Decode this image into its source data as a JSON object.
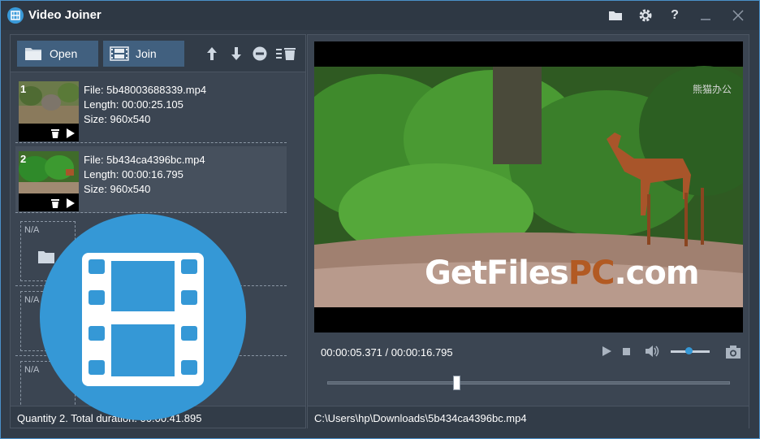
{
  "window": {
    "title": "Video Joiner",
    "accent_color": "#3598d6",
    "titlebar_icons": [
      "folder-icon",
      "gear-icon",
      "help-icon",
      "minimize-icon",
      "close-icon"
    ],
    "help_label": "?"
  },
  "toolbar": {
    "open_label": "Open",
    "join_label": "Join",
    "tools": [
      "move-up-icon",
      "move-down-icon",
      "remove-icon",
      "clear-list-icon"
    ]
  },
  "files": [
    {
      "index": "1",
      "file": "File: 5b48003688339.mp4",
      "length": "Length: 00:00:25.105",
      "size": "Size: 960x540"
    },
    {
      "index": "2",
      "file": "File: 5b434ca4396bc.mp4",
      "length": "Length: 00:00:16.795",
      "size": "Size: 960x540"
    }
  ],
  "empty_slots": [
    {
      "label": "N/A"
    },
    {
      "label": "N/A"
    },
    {
      "label": "N/A"
    }
  ],
  "status": {
    "left": "Quantity 2. Total duration: 00:00:41.895",
    "right": "C:\\Users\\hp\\Downloads\\5b434ca4396bc.mp4"
  },
  "player": {
    "time": "00:00:05.371 / 00:00:16.795",
    "seek_fraction": 0.32,
    "volume_fraction": 0.45,
    "watermark": "熊猫办公",
    "overlay_brand_a": "GetFiles",
    "overlay_brand_b": "PC",
    "overlay_brand_c": ".com"
  }
}
